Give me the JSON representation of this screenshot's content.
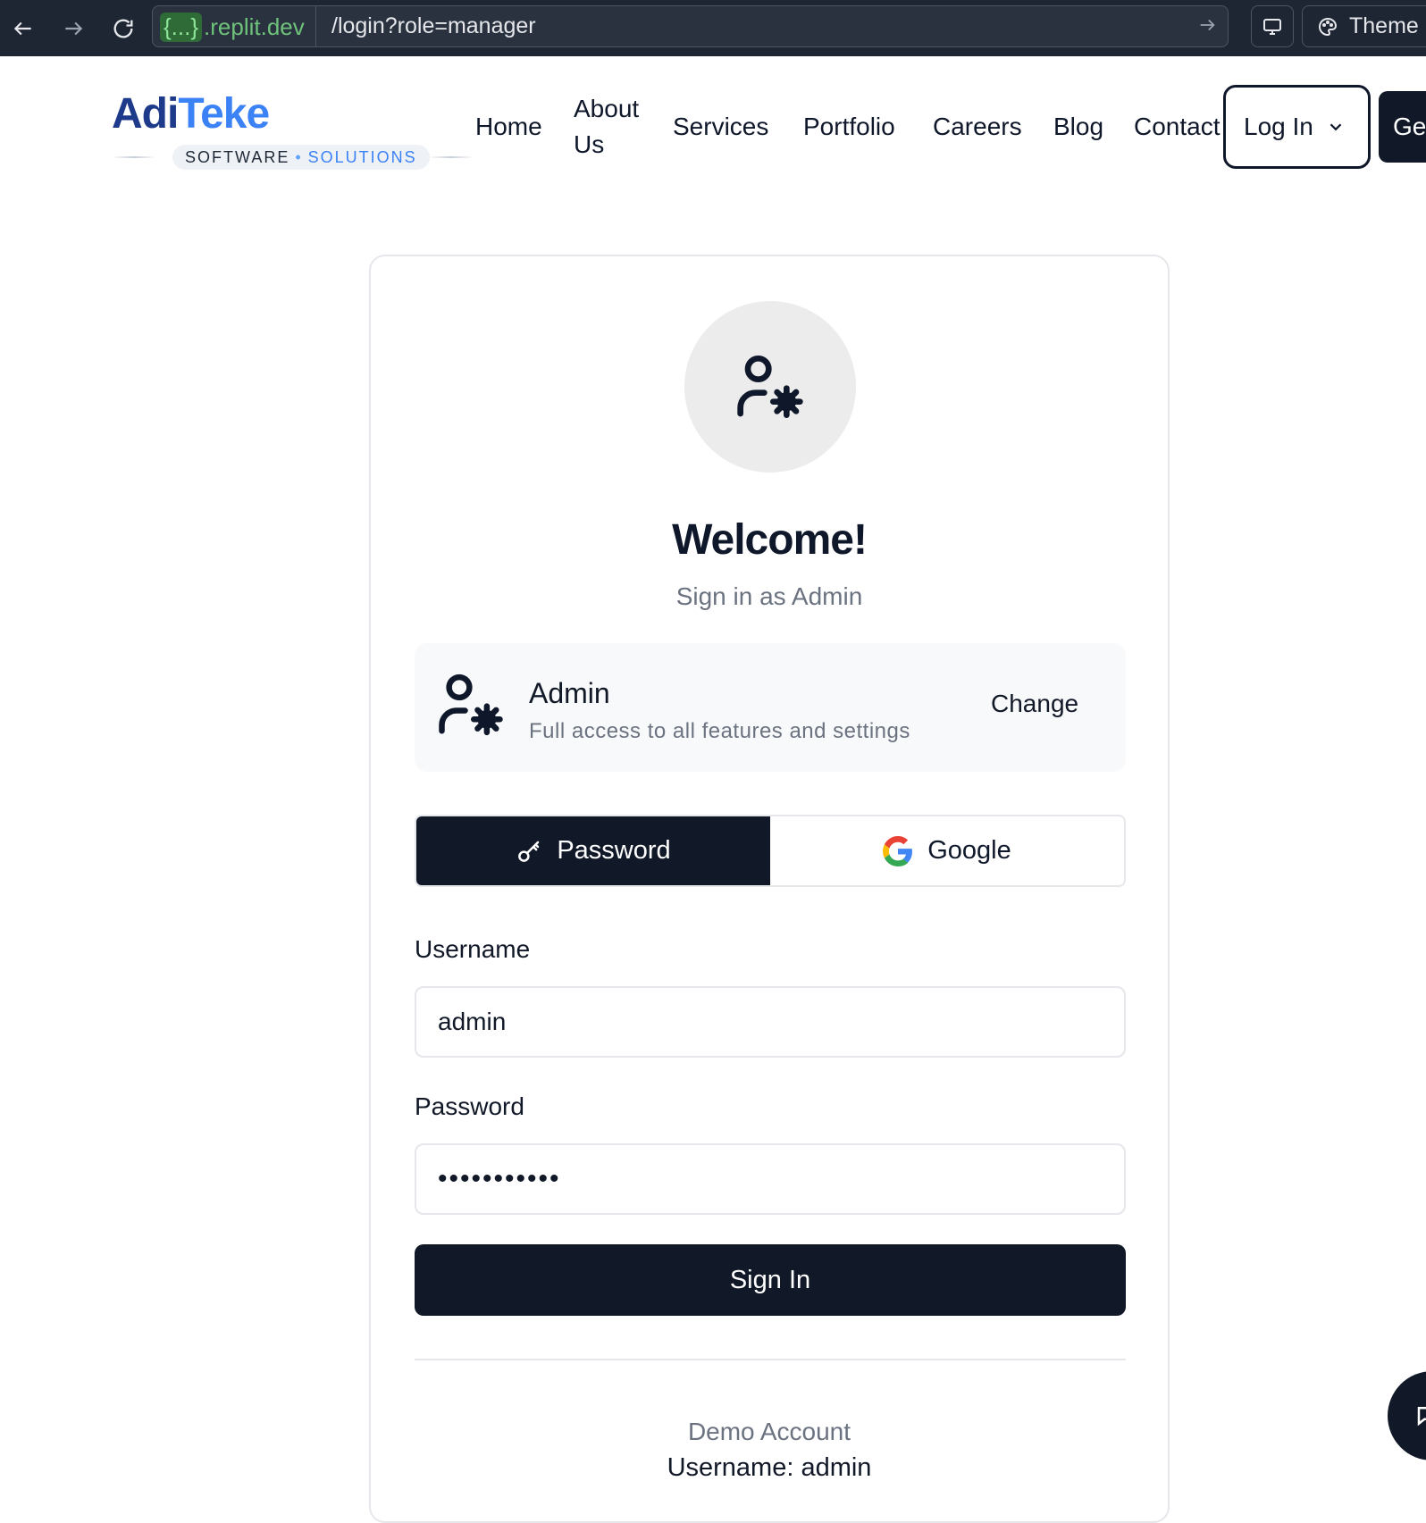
{
  "browser": {
    "url_host_prefix": "{...}",
    "url_host": ".replit.dev",
    "url_path": "/login?role=manager",
    "theme_label": "Theme"
  },
  "header": {
    "logo_part1": "Adi",
    "logo_part2": "Teke",
    "logo_sub1": "SOFTWARE",
    "logo_sub_sep": "•",
    "logo_sub2": "SOLUTIONS",
    "nav": [
      {
        "label": "Home"
      },
      {
        "label": "About"
      },
      {
        "label": "Us"
      },
      {
        "label": "Services"
      },
      {
        "label": "Portfolio"
      },
      {
        "label": "Careers"
      },
      {
        "label": "Blog"
      },
      {
        "label": "Contact"
      }
    ],
    "login_label": "Log In",
    "get_started_label": "Ge"
  },
  "card": {
    "welcome": "Welcome!",
    "subtitle": "Sign in as Admin",
    "role": {
      "name": "Admin",
      "description": "Full access to all features and settings",
      "change_label": "Change"
    },
    "tabs": [
      {
        "label": "Password",
        "active": true
      },
      {
        "label": "Google",
        "active": false
      }
    ],
    "username_label": "Username",
    "username_value": "admin",
    "password_label": "Password",
    "password_value": "•••••••••••",
    "signin_label": "Sign In",
    "demo_title": "Demo Account",
    "demo_user": "Username: admin"
  },
  "colors": {
    "primary": "#111827",
    "brand_dark": "#1e3a8a",
    "brand_light": "#3b82f6",
    "muted": "#6b7280"
  }
}
